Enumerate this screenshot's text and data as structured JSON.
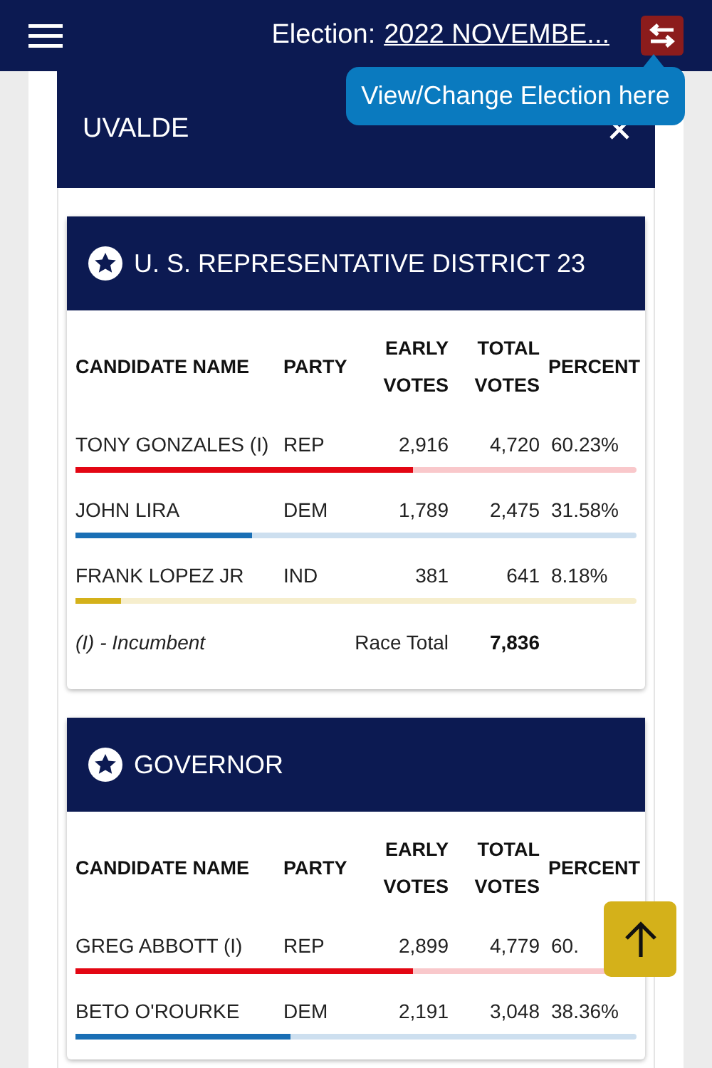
{
  "header": {
    "election_label": "Election:",
    "election_name": "2022 NOVEMBE..."
  },
  "tooltip": "View/Change Election here",
  "county": {
    "name": "UVALDE",
    "expanded": true
  },
  "races": [
    {
      "title": "U. S. REPRESENTATIVE DISTRICT 23",
      "columns": [
        "CANDIDATE NAME",
        "PARTY",
        "EARLY VOTES",
        "TOTAL VOTES",
        "PERCENT"
      ],
      "candidates": [
        {
          "name": "TONY GONZALES (I)",
          "party": "REP",
          "early": "2,916",
          "total": "4,720",
          "percent": "60.23%",
          "level": 0.6023,
          "color": "#e30613"
        },
        {
          "name": "JOHN LIRA",
          "party": "DEM",
          "early": "1,789",
          "total": "2,475",
          "percent": "31.58%",
          "level": 0.3158,
          "color": "#1a6fb5"
        },
        {
          "name": "FRANK LOPEZ JR",
          "party": "IND",
          "early": "381",
          "total": "641",
          "percent": "8.18%",
          "level": 0.0818,
          "color": "#d4b11a"
        }
      ],
      "footer": {
        "note": "(I) - Incumbent",
        "total_label": "Race Total",
        "total": "7,836"
      }
    },
    {
      "title": "GOVERNOR",
      "columns": [
        "CANDIDATE NAME",
        "PARTY",
        "EARLY VOTES",
        "TOTAL VOTES",
        "PERCENT"
      ],
      "candidates": [
        {
          "name": "GREG ABBOTT (I)",
          "party": "REP",
          "early": "2,899",
          "total": "4,779",
          "percent": "60.",
          "level": 0.6013,
          "color": "#e30613"
        },
        {
          "name": "BETO O'ROURKE",
          "party": "DEM",
          "early": "2,191",
          "total": "3,048",
          "percent": "38.36%",
          "level": 0.3836,
          "color": "#1a6fb5"
        }
      ]
    }
  ]
}
